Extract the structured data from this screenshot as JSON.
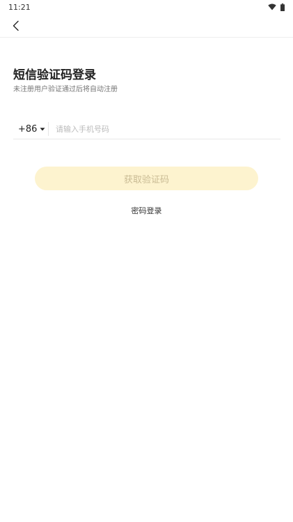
{
  "status": {
    "time": "11:21",
    "wifi_icon": "wifi-icon",
    "battery_icon": "battery-icon"
  },
  "nav": {
    "back_icon": "chevron-left-icon"
  },
  "login": {
    "title": "短信验证码登录",
    "subtitle": "未注册用户验证通过后将自动注册",
    "country_code": "+86",
    "phone_placeholder": "请输入手机号码",
    "phone_value": "",
    "get_code_label": "获取验证码",
    "password_login_label": "密码登录"
  },
  "colors": {
    "button_bg": "#fdf3cf",
    "button_text": "#c9bb94"
  }
}
